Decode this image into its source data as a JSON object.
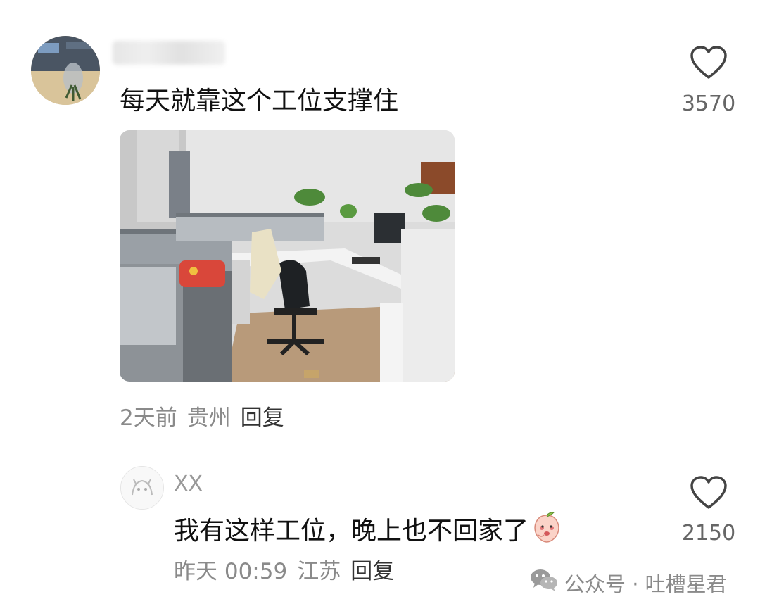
{
  "comment1": {
    "text": "每天就靠这个工位支撑住",
    "like_count": "3570",
    "time": "2天前",
    "location": "贵州",
    "reply_label": "回复"
  },
  "comment2": {
    "username": "XX",
    "text": "我有这样工位，晚上也不回家了",
    "emoji_icon": "peach-emoji-icon",
    "like_count": "2150",
    "time": "昨天 00:59",
    "location": "江苏",
    "reply_label": "回复"
  },
  "watermark": {
    "text": "公众号 · 吐槽星君",
    "icon": "wechat-icon"
  }
}
